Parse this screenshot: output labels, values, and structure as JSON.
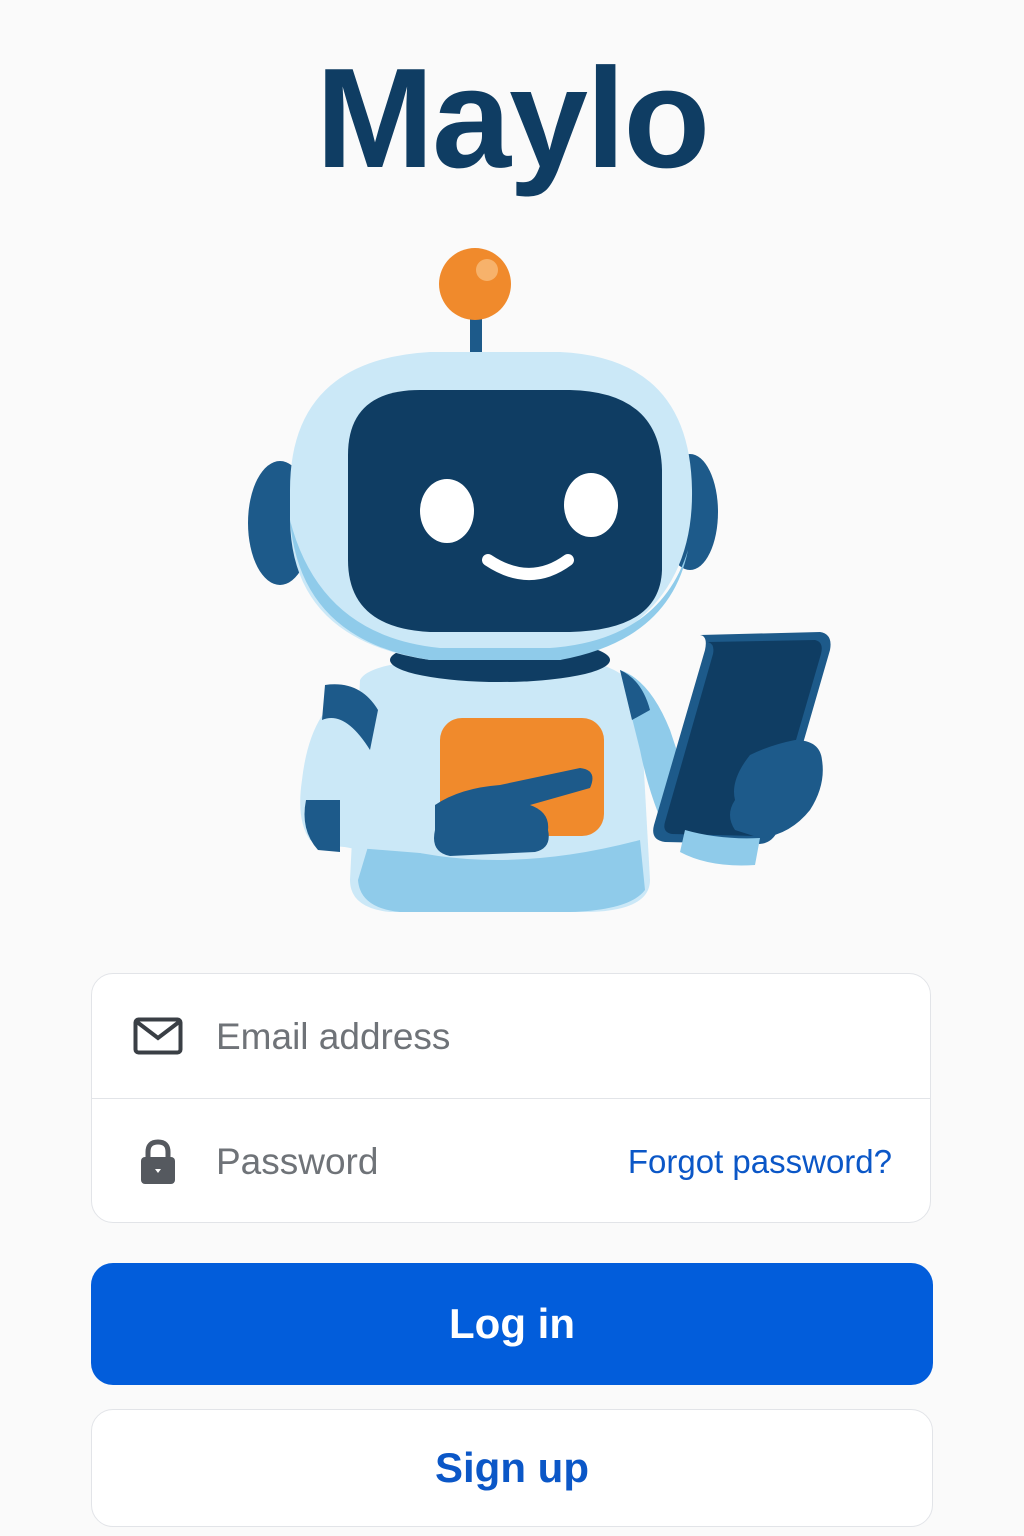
{
  "app": {
    "title": "Maylo"
  },
  "mascot": {
    "icon": "robot-mascot-icon"
  },
  "login_form": {
    "email": {
      "icon": "envelope-icon",
      "placeholder": "Email address",
      "value": ""
    },
    "password": {
      "icon": "lock-icon",
      "placeholder": "Password",
      "value": "",
      "forgot_label": "Forgot password?"
    }
  },
  "actions": {
    "login_label": "Log in",
    "signup_label": "Sign up"
  },
  "colors": {
    "brand_navy": "#0f3d63",
    "primary_blue": "#025ddb",
    "link_blue": "#0b57c7",
    "accent_orange": "#f08a2c",
    "robot_light_blue": "#cbe8f7"
  }
}
